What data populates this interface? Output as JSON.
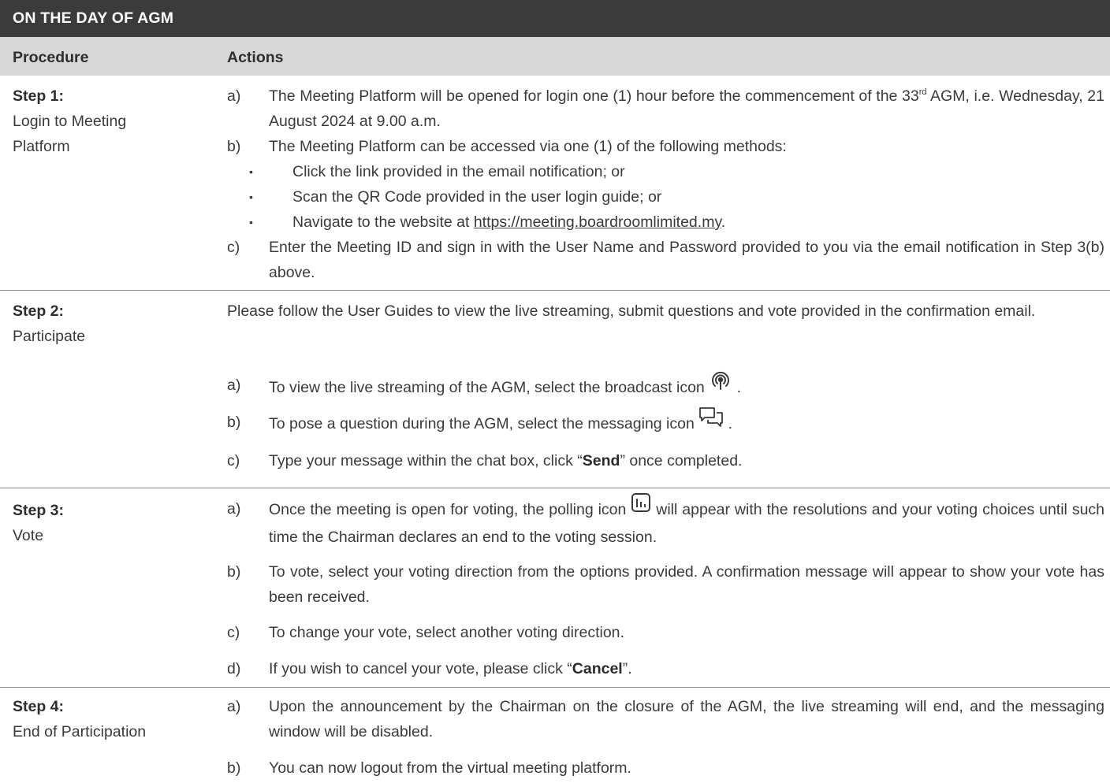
{
  "title": "ON THE DAY OF AGM",
  "header": {
    "procedure": "Procedure",
    "actions": "Actions"
  },
  "step1": {
    "step": "Step 1:",
    "desc_line1": "Login to Meeting",
    "desc_line2": "Platform",
    "a_label": "a)",
    "a_text1": "The Meeting Platform will be opened for login one (1) hour before the commencement of the 33",
    "a_sup": "rd",
    "a_text2": " AGM, i.e. Wednesday, 21 August 2024 at 9.00 a.m.",
    "b_label": "b)",
    "b_text": "The Meeting Platform can be accessed via one (1) of the following methods:",
    "bullets": [
      "Click the link provided in the email notification; or",
      "Scan the QR Code provided in the user login guide; or"
    ],
    "bullet3_pre": "Navigate to the website at ",
    "bullet3_link": "https://meeting.boardroomlimited.my",
    "bullet3_post": ".",
    "c_label": "c)",
    "c_text": "Enter the Meeting ID and sign in with the User Name and Password provided to you via the email notification in Step 3(b) above."
  },
  "step2": {
    "step": "Step 2:",
    "desc": "Participate",
    "intro": "Please follow the User Guides to view the live streaming, submit questions and vote provided in the confirmation email.",
    "a_label": "a)",
    "a_text": "To view the live streaming of the AGM, select the broadcast icon",
    "a_end": " .",
    "b_label": "b)",
    "b_text": "To pose a question during the AGM, select the messaging icon",
    "b_end": " .",
    "c_label": "c)",
    "c_pre": "Type your message within the chat box, click “",
    "c_bold": "Send",
    "c_post": "” once completed."
  },
  "step3": {
    "step": "Step 3:",
    "desc": "Vote",
    "a_label": "a)",
    "a_pre": "Once the meeting is open for voting, the polling icon",
    "a_post": " will appear with the resolutions and your voting choices until such time the Chairman declares an end to the voting session.",
    "b_label": "b)",
    "b_text": "To vote, select your voting direction from the options provided. A confirmation message will appear to show your vote has been received.",
    "c_label": "c)",
    "c_text": "To change your vote, select another voting direction.",
    "d_label": "d)",
    "d_pre": "If you wish to cancel your vote, please click “",
    "d_bold": "Cancel",
    "d_post": "”."
  },
  "step4": {
    "step": "Step 4:",
    "desc": "End of Participation",
    "a_label": "a)",
    "a_text": "Upon the announcement by the Chairman on the closure of the AGM, the live streaming will end, and the messaging window will be disabled.",
    "b_label": "b)",
    "b_text": "You can now logout from the virtual meeting platform."
  },
  "colors": {
    "title_bg": "#3b3b3b",
    "header_bg": "#d8d8d8",
    "text": "#3a3a3a"
  }
}
